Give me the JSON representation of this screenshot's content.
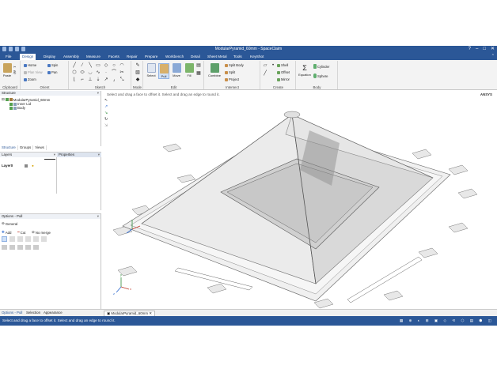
{
  "window": {
    "title": "ModularPyramid_60mm - SpaceClaim"
  },
  "tabs": [
    "File",
    "Design",
    "Display",
    "Assembly",
    "Measure",
    "Facets",
    "Repair",
    "Prepare",
    "Workbench",
    "Detail",
    "Sheet Metal",
    "Tools",
    "KeyShot"
  ],
  "active_tab": "Design",
  "ribbon": {
    "clipboard": {
      "label": "Clipboard",
      "paste": "Paste"
    },
    "orient": {
      "label": "Orient",
      "home": "Home",
      "plan_view": "Plan View",
      "zoom": "Zoom",
      "spin": "Spin",
      "pan": "Pan"
    },
    "sketch": {
      "label": "Sketch"
    },
    "mode": {
      "label": "Mode"
    },
    "edit": {
      "label": "Edit",
      "select": "Select",
      "pull": "Pull",
      "move": "Move",
      "fill": "Fill"
    },
    "intersect": {
      "label": "Intersect",
      "combine": "Combine",
      "split_body": "Split Body",
      "split": "Split",
      "project": "Project"
    },
    "create": {
      "label": "Create",
      "shell": "Shell",
      "offset": "Offset",
      "mirror": "Mirror"
    },
    "body": {
      "label": "Body",
      "equation": "Equation",
      "cylinder": "Cylinder",
      "sphere": "Sphere"
    }
  },
  "structure": {
    "header": "Structure",
    "root": "ModularPyramid_60mm",
    "children": [
      "Inner Lid",
      "Body"
    ],
    "tabs": [
      "Structure",
      "Groups",
      "Views"
    ]
  },
  "layers": {
    "header": "Layers",
    "properties_header": "Properties",
    "row": "Layer0"
  },
  "options": {
    "header": "Options - Pull",
    "general": "General",
    "add": "Add",
    "cut": "Cut",
    "no_merge": "No merge"
  },
  "bottom_tabs": [
    "Options - Pull",
    "Selection",
    "Appearance"
  ],
  "doc_tab": "ModularPyramid_60mm",
  "viewport_hint": "Select and drag a face to offset it. Select and drag an edge to round it.",
  "brand": "ANSYS",
  "status_text": "Select and drag a face to offset it. Select and drag an edge to round it.",
  "colors": {
    "accent": "#2b5797",
    "panel_header": "#eef1f6"
  }
}
